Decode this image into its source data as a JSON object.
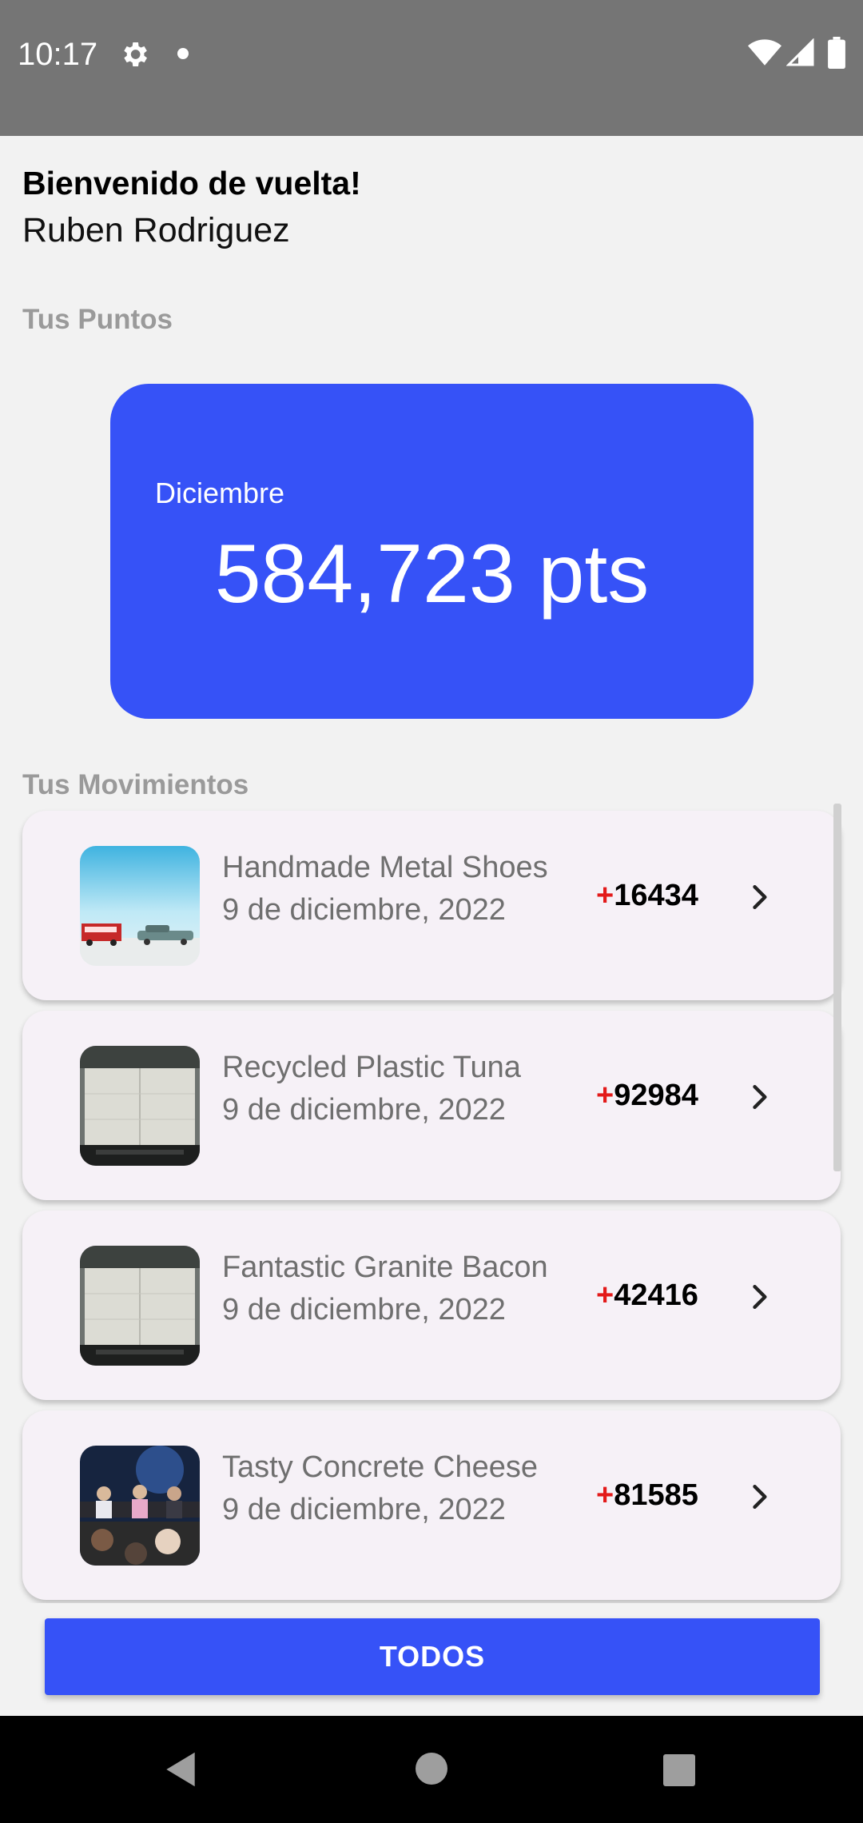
{
  "status_bar": {
    "time": "10:17",
    "icons": [
      "gear-icon",
      "notification-dot-icon",
      "wifi-icon",
      "signal-icon",
      "battery-icon"
    ]
  },
  "header": {
    "greeting": "Bienvenido de vuelta!",
    "user_name": "Ruben Rodriguez"
  },
  "points": {
    "section_label": "Tus Puntos",
    "month": "Diciembre",
    "value": "584,723 pts",
    "card_color": "#3652f7"
  },
  "movements": {
    "section_label": "Tus Movimientos",
    "items": [
      {
        "title": "Handmade Metal Shoes",
        "date": "9 de diciembre, 2022",
        "sign": "+",
        "amount": "16434",
        "thumb": "photo-bus-desert"
      },
      {
        "title": "Recycled Plastic Tuna",
        "date": "9 de diciembre, 2022",
        "sign": "+",
        "amount": "92984",
        "thumb": "photo-warehouse-wall"
      },
      {
        "title": "Fantastic Granite Bacon",
        "date": "9 de diciembre, 2022",
        "sign": "+",
        "amount": "42416",
        "thumb": "photo-warehouse-wall"
      },
      {
        "title": "Tasty Concrete Cheese",
        "date": "9 de diciembre, 2022",
        "sign": "+",
        "amount": "81585",
        "thumb": "photo-conference-panel"
      }
    ]
  },
  "actions": {
    "all_label": "TODOS"
  },
  "colors": {
    "accent": "#3652f7",
    "positive_sign": "#e31a1a",
    "status_bar": "#757575"
  }
}
